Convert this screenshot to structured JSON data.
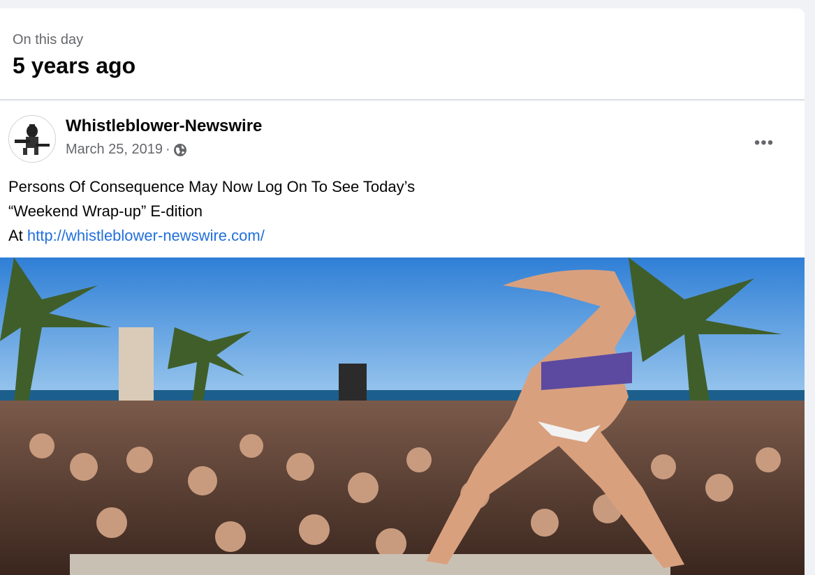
{
  "memory": {
    "label": "On this day",
    "title": "5 years ago"
  },
  "post": {
    "author": "Whistleblower-Newswire",
    "date": "March 25, 2019",
    "separator": "·",
    "privacy_icon": "globe-icon",
    "more_icon": "more-options-icon",
    "more_label": "•••",
    "text_line1": "Persons Of Consequence May Now Log On To See Today’s",
    "text_line2": "“Weekend Wrap-up” E-dition",
    "text_line3_prefix": "At ",
    "link_text": "http://whistleblower-newswire.com/",
    "photo_alt": "Spring break beach party crowd photo"
  },
  "colors": {
    "background": "#f0f2f5",
    "card": "#ffffff",
    "secondary_text": "#65676b",
    "link": "#216fdb"
  }
}
